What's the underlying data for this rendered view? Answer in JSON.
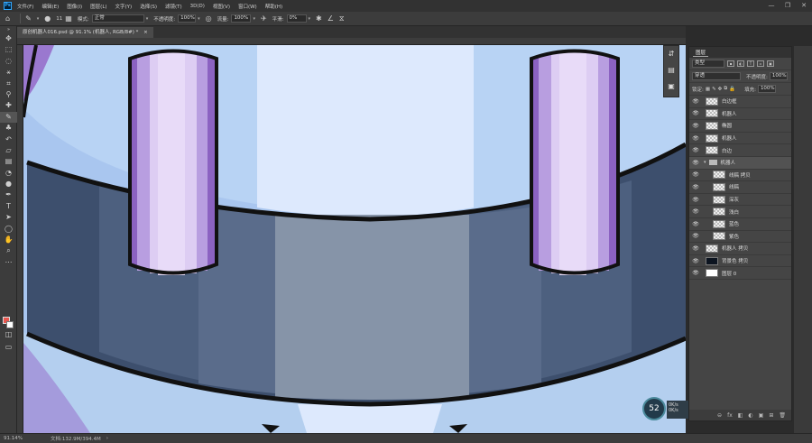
{
  "app": {
    "logo": "Ps"
  },
  "menu": [
    "文件(F)",
    "编辑(E)",
    "图像(I)",
    "图层(L)",
    "文字(Y)",
    "选择(S)",
    "滤镜(T)",
    "3D(D)",
    "视图(V)",
    "窗口(W)",
    "帮助(H)"
  ],
  "window_controls": [
    "—",
    "❐",
    "✕"
  ],
  "options": {
    "brush_size": "11",
    "mode_label": "模式:",
    "mode_value": "正常",
    "opacity_label": "不透明度:",
    "opacity_value": "100%",
    "flow_label": "流量:",
    "flow_value": "100%",
    "smooth_label": "平滑:",
    "smooth_value": "0%"
  },
  "document_tab": {
    "title": "原创机器人016.psd @ 91.1% (机器人, RGB/8#) *",
    "close": "×"
  },
  "layers_panel": {
    "tab": "图层",
    "kind_filter": "类型",
    "blend": "穿透",
    "opacity_label": "不透明度:",
    "opacity_value": "100%",
    "lock_label": "锁定:",
    "fill_label": "填充:",
    "fill_value": "100%",
    "layers": [
      {
        "name": "白边框",
        "type": "layer",
        "indent": false
      },
      {
        "name": "机器人",
        "type": "layer",
        "indent": false
      },
      {
        "name": "椭圆",
        "type": "layer",
        "indent": false
      },
      {
        "name": "机器人",
        "type": "layer",
        "indent": false
      },
      {
        "name": "白边",
        "type": "layer",
        "indent": false
      },
      {
        "name": "机器人",
        "type": "group",
        "indent": false
      },
      {
        "name": "线稿 拷贝",
        "type": "layer",
        "indent": true
      },
      {
        "name": "线稿",
        "type": "layer",
        "indent": true
      },
      {
        "name": "深灰",
        "type": "layer",
        "indent": true
      },
      {
        "name": "浅白",
        "type": "layer",
        "indent": true
      },
      {
        "name": "蓝色",
        "type": "layer",
        "indent": true
      },
      {
        "name": "紫色",
        "type": "layer",
        "indent": true
      },
      {
        "name": "机器人 拷贝",
        "type": "layer",
        "indent": false
      },
      {
        "name": "背景色 拷贝",
        "type": "layer",
        "indent": false
      },
      {
        "name": "图层 0",
        "type": "layer",
        "indent": false
      }
    ],
    "footer_icons": [
      "⊖",
      "fx",
      "◧",
      "◐",
      "▣",
      "⊞",
      "🗑"
    ]
  },
  "hud": {
    "zoom": "52",
    "stat1": "0K/s",
    "stat2": "0K/s"
  },
  "status": {
    "zoom": "91.14%",
    "doc": "文档:132.9M/394.4M"
  },
  "colors": {
    "foreground": "#e8574f",
    "background": "#ffffff"
  }
}
